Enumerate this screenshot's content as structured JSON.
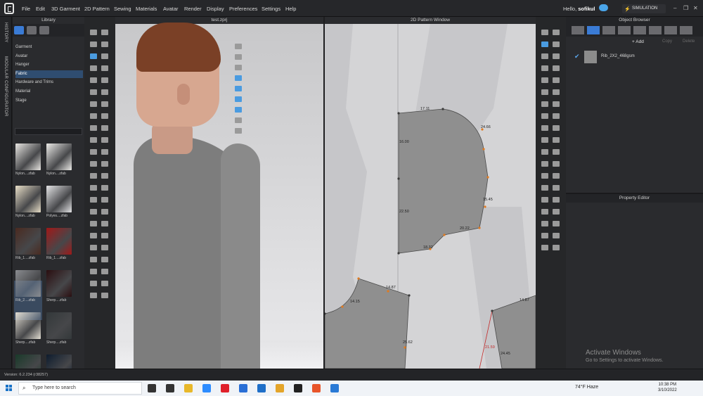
{
  "app": {
    "menu": [
      "File",
      "Edit",
      "3D Garment",
      "2D Pattern",
      "Sewing",
      "Materials",
      "Avatar",
      "Render",
      "Display",
      "Preferences",
      "Settings",
      "Help"
    ],
    "greeting": "Hello, ",
    "username": "sofikul",
    "simulation_label": "SIMULATION",
    "window_controls": [
      "–",
      "❐",
      "✕"
    ]
  },
  "side_strip": {
    "history": "HISTORY",
    "modular": "MODULAR CONFIGURATOR"
  },
  "library": {
    "title": "Library",
    "categories": [
      {
        "label": "Garment"
      },
      {
        "label": "Avatar"
      },
      {
        "label": "Hanger"
      },
      {
        "label": "Fabric",
        "selected": true
      },
      {
        "label": "Hardware and Trims"
      },
      {
        "label": "Material"
      },
      {
        "label": "Stage"
      }
    ],
    "thumbnails": [
      {
        "label": "Nylon....zfab",
        "color": "#e8e6e2"
      },
      {
        "label": "Nylon....zfab",
        "color": "#ecebe8"
      },
      {
        "label": "Nylon....zfab",
        "color": "#e9dfc8"
      },
      {
        "label": "Polyes....zfab",
        "color": "#e4e4e6"
      },
      {
        "label": "Rib_1....zfab",
        "color": "#4a2a20"
      },
      {
        "label": "Rib_1....zfab",
        "color": "#a01818"
      },
      {
        "label": "Rib_2....zfab",
        "color": "#8a8c90"
      },
      {
        "label": "Sherp....zfab",
        "color": "#2a0e10"
      },
      {
        "label": "Sherp....zfab",
        "color": "#e2ddd2"
      },
      {
        "label": "Sherp....zfab",
        "color": "#33383a"
      },
      {
        "label": "",
        "color": "#1a3a2a"
      },
      {
        "label": "",
        "color": "#0e1c2e"
      }
    ]
  },
  "viewport3d": {
    "title": "test.zprj"
  },
  "pattern2d": {
    "title": "2D Pattern Window",
    "dimensions": [
      {
        "text": "17.11",
        "red": false
      },
      {
        "text": "24.66",
        "red": false
      },
      {
        "text": "16.00",
        "red": false
      },
      {
        "text": "15.45",
        "red": false
      },
      {
        "text": "22.50",
        "red": false
      },
      {
        "text": "20.22",
        "red": false
      },
      {
        "text": "18.32",
        "red": false
      },
      {
        "text": "14.87",
        "red": false
      },
      {
        "text": "14.15",
        "red": false
      },
      {
        "text": "25.62",
        "red": false
      },
      {
        "text": "14.87",
        "red": false
      },
      {
        "text": "21.59",
        "red": true
      },
      {
        "text": "24.45",
        "red": false
      }
    ]
  },
  "object_browser": {
    "title": "Object Browser",
    "add": "+ Add",
    "copy": "Copy",
    "delete": "Delete",
    "fabric_name": "Rib_2X2_468gsm"
  },
  "property_editor": {
    "title": "Property Editor",
    "activate_title": "Activate Windows",
    "activate_sub": "Go to Settings to activate Windows."
  },
  "status": {
    "version": "Version: 6.2.234 (r38257)"
  },
  "taskbar": {
    "search_placeholder": "Type here to search",
    "weather": "74°F  Haze",
    "time": "10:38 PM",
    "date": "3/10/2022",
    "icons": [
      {
        "name": "cortana-icon",
        "color": "#333333"
      },
      {
        "name": "task-view-icon",
        "color": "#333333"
      },
      {
        "name": "file-explorer-icon",
        "color": "#e8b82a"
      },
      {
        "name": "zoom-icon",
        "color": "#2d8cff"
      },
      {
        "name": "opera-icon",
        "color": "#e0202a"
      },
      {
        "name": "store-icon",
        "color": "#2a6fd6"
      },
      {
        "name": "mail-icon",
        "color": "#1f6fc8"
      },
      {
        "name": "chrome-icon",
        "color": "#e4a52a"
      },
      {
        "name": "clo-icon",
        "color": "#222222"
      },
      {
        "name": "app-orange-icon",
        "color": "#e8552a"
      },
      {
        "name": "app-blue-icon",
        "color": "#2a7ad6"
      }
    ]
  },
  "colors": {
    "accent_blue": "#4a9be0",
    "panel_bg": "#2a2b2e",
    "pattern_piece": "#8f8f8f",
    "dim_red": "#c42a2a",
    "point_orange": "#e07a20"
  }
}
